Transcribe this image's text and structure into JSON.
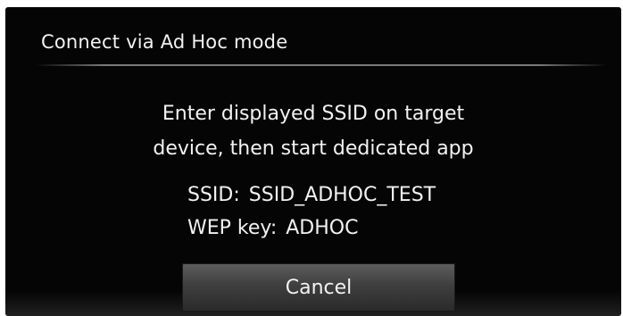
{
  "dialog": {
    "title": "Connect via Ad Hoc mode",
    "message_lines": [
      "Enter displayed SSID on target",
      "device, then start dedicated app"
    ],
    "ssid_label": "SSID:",
    "ssid_value": "SSID_ADHOC_TEST",
    "wep_label": "WEP key:",
    "wep_value": "ADHOC",
    "cancel_label": "Cancel"
  },
  "colors": {
    "background": "#050505",
    "text": "#f2f2f2",
    "button": "#4a4a4a"
  }
}
